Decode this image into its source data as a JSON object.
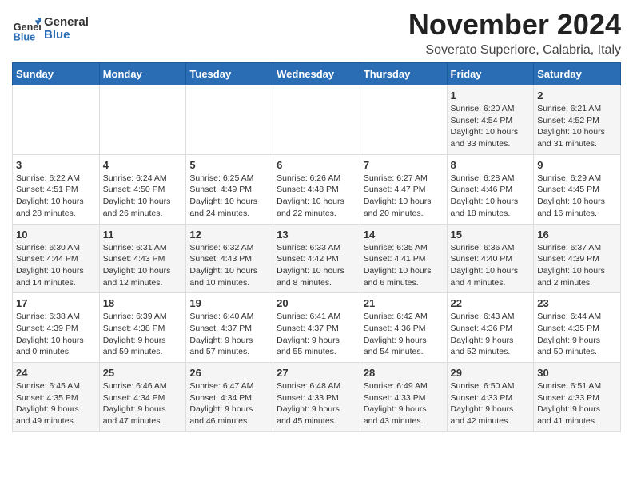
{
  "logo": {
    "line1": "General",
    "line2": "Blue"
  },
  "title": "November 2024",
  "subtitle": "Soverato Superiore, Calabria, Italy",
  "weekdays": [
    "Sunday",
    "Monday",
    "Tuesday",
    "Wednesday",
    "Thursday",
    "Friday",
    "Saturday"
  ],
  "weeks": [
    [
      {
        "day": "",
        "info": ""
      },
      {
        "day": "",
        "info": ""
      },
      {
        "day": "",
        "info": ""
      },
      {
        "day": "",
        "info": ""
      },
      {
        "day": "",
        "info": ""
      },
      {
        "day": "1",
        "info": "Sunrise: 6:20 AM\nSunset: 4:54 PM\nDaylight: 10 hours\nand 33 minutes."
      },
      {
        "day": "2",
        "info": "Sunrise: 6:21 AM\nSunset: 4:52 PM\nDaylight: 10 hours\nand 31 minutes."
      }
    ],
    [
      {
        "day": "3",
        "info": "Sunrise: 6:22 AM\nSunset: 4:51 PM\nDaylight: 10 hours\nand 28 minutes."
      },
      {
        "day": "4",
        "info": "Sunrise: 6:24 AM\nSunset: 4:50 PM\nDaylight: 10 hours\nand 26 minutes."
      },
      {
        "day": "5",
        "info": "Sunrise: 6:25 AM\nSunset: 4:49 PM\nDaylight: 10 hours\nand 24 minutes."
      },
      {
        "day": "6",
        "info": "Sunrise: 6:26 AM\nSunset: 4:48 PM\nDaylight: 10 hours\nand 22 minutes."
      },
      {
        "day": "7",
        "info": "Sunrise: 6:27 AM\nSunset: 4:47 PM\nDaylight: 10 hours\nand 20 minutes."
      },
      {
        "day": "8",
        "info": "Sunrise: 6:28 AM\nSunset: 4:46 PM\nDaylight: 10 hours\nand 18 minutes."
      },
      {
        "day": "9",
        "info": "Sunrise: 6:29 AM\nSunset: 4:45 PM\nDaylight: 10 hours\nand 16 minutes."
      }
    ],
    [
      {
        "day": "10",
        "info": "Sunrise: 6:30 AM\nSunset: 4:44 PM\nDaylight: 10 hours\nand 14 minutes."
      },
      {
        "day": "11",
        "info": "Sunrise: 6:31 AM\nSunset: 4:43 PM\nDaylight: 10 hours\nand 12 minutes."
      },
      {
        "day": "12",
        "info": "Sunrise: 6:32 AM\nSunset: 4:43 PM\nDaylight: 10 hours\nand 10 minutes."
      },
      {
        "day": "13",
        "info": "Sunrise: 6:33 AM\nSunset: 4:42 PM\nDaylight: 10 hours\nand 8 minutes."
      },
      {
        "day": "14",
        "info": "Sunrise: 6:35 AM\nSunset: 4:41 PM\nDaylight: 10 hours\nand 6 minutes."
      },
      {
        "day": "15",
        "info": "Sunrise: 6:36 AM\nSunset: 4:40 PM\nDaylight: 10 hours\nand 4 minutes."
      },
      {
        "day": "16",
        "info": "Sunrise: 6:37 AM\nSunset: 4:39 PM\nDaylight: 10 hours\nand 2 minutes."
      }
    ],
    [
      {
        "day": "17",
        "info": "Sunrise: 6:38 AM\nSunset: 4:39 PM\nDaylight: 10 hours\nand 0 minutes."
      },
      {
        "day": "18",
        "info": "Sunrise: 6:39 AM\nSunset: 4:38 PM\nDaylight: 9 hours\nand 59 minutes."
      },
      {
        "day": "19",
        "info": "Sunrise: 6:40 AM\nSunset: 4:37 PM\nDaylight: 9 hours\nand 57 minutes."
      },
      {
        "day": "20",
        "info": "Sunrise: 6:41 AM\nSunset: 4:37 PM\nDaylight: 9 hours\nand 55 minutes."
      },
      {
        "day": "21",
        "info": "Sunrise: 6:42 AM\nSunset: 4:36 PM\nDaylight: 9 hours\nand 54 minutes."
      },
      {
        "day": "22",
        "info": "Sunrise: 6:43 AM\nSunset: 4:36 PM\nDaylight: 9 hours\nand 52 minutes."
      },
      {
        "day": "23",
        "info": "Sunrise: 6:44 AM\nSunset: 4:35 PM\nDaylight: 9 hours\nand 50 minutes."
      }
    ],
    [
      {
        "day": "24",
        "info": "Sunrise: 6:45 AM\nSunset: 4:35 PM\nDaylight: 9 hours\nand 49 minutes."
      },
      {
        "day": "25",
        "info": "Sunrise: 6:46 AM\nSunset: 4:34 PM\nDaylight: 9 hours\nand 47 minutes."
      },
      {
        "day": "26",
        "info": "Sunrise: 6:47 AM\nSunset: 4:34 PM\nDaylight: 9 hours\nand 46 minutes."
      },
      {
        "day": "27",
        "info": "Sunrise: 6:48 AM\nSunset: 4:33 PM\nDaylight: 9 hours\nand 45 minutes."
      },
      {
        "day": "28",
        "info": "Sunrise: 6:49 AM\nSunset: 4:33 PM\nDaylight: 9 hours\nand 43 minutes."
      },
      {
        "day": "29",
        "info": "Sunrise: 6:50 AM\nSunset: 4:33 PM\nDaylight: 9 hours\nand 42 minutes."
      },
      {
        "day": "30",
        "info": "Sunrise: 6:51 AM\nSunset: 4:33 PM\nDaylight: 9 hours\nand 41 minutes."
      }
    ]
  ]
}
